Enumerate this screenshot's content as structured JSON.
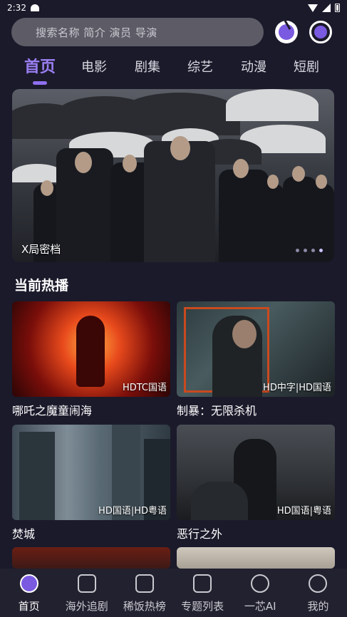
{
  "status_bar": {
    "time": "2:32"
  },
  "search": {
    "placeholder": "搜索名称 简介 演员 导演"
  },
  "tabs": [
    {
      "label": "首页",
      "active": true
    },
    {
      "label": "电影",
      "active": false
    },
    {
      "label": "剧集",
      "active": false
    },
    {
      "label": "综艺",
      "active": false
    },
    {
      "label": "动漫",
      "active": false
    },
    {
      "label": "短剧",
      "active": false
    }
  ],
  "banner": {
    "title": "X局密档",
    "slides": 4,
    "active_slide": 4
  },
  "section": {
    "title": "当前热播"
  },
  "cards": [
    {
      "name": "哪吒之魔童闹海",
      "tag": "HDTC国语"
    },
    {
      "name": "制暴：无限杀机",
      "tag": "HD中字|HD国语"
    },
    {
      "name": "焚城",
      "tag": "HD国语|HD粤语"
    },
    {
      "name": "恶行之外",
      "tag": "HD国语|粤语"
    },
    {
      "name": "",
      "tag": ""
    },
    {
      "name": "",
      "tag": ""
    }
  ],
  "bottom_nav": [
    {
      "label": "首页",
      "icon": "home-icon",
      "active": true
    },
    {
      "label": "海外追剧",
      "icon": "calendar-icon",
      "active": false
    },
    {
      "label": "稀饭热榜",
      "icon": "chart-icon",
      "active": false
    },
    {
      "label": "专题列表",
      "icon": "list-icon",
      "active": false
    },
    {
      "label": "一芯AI",
      "icon": "planet-icon",
      "active": false
    },
    {
      "label": "我的",
      "icon": "profile-icon",
      "active": false
    }
  ],
  "colors": {
    "background": "#1b1a2b",
    "accent": "#8f6ff0"
  }
}
